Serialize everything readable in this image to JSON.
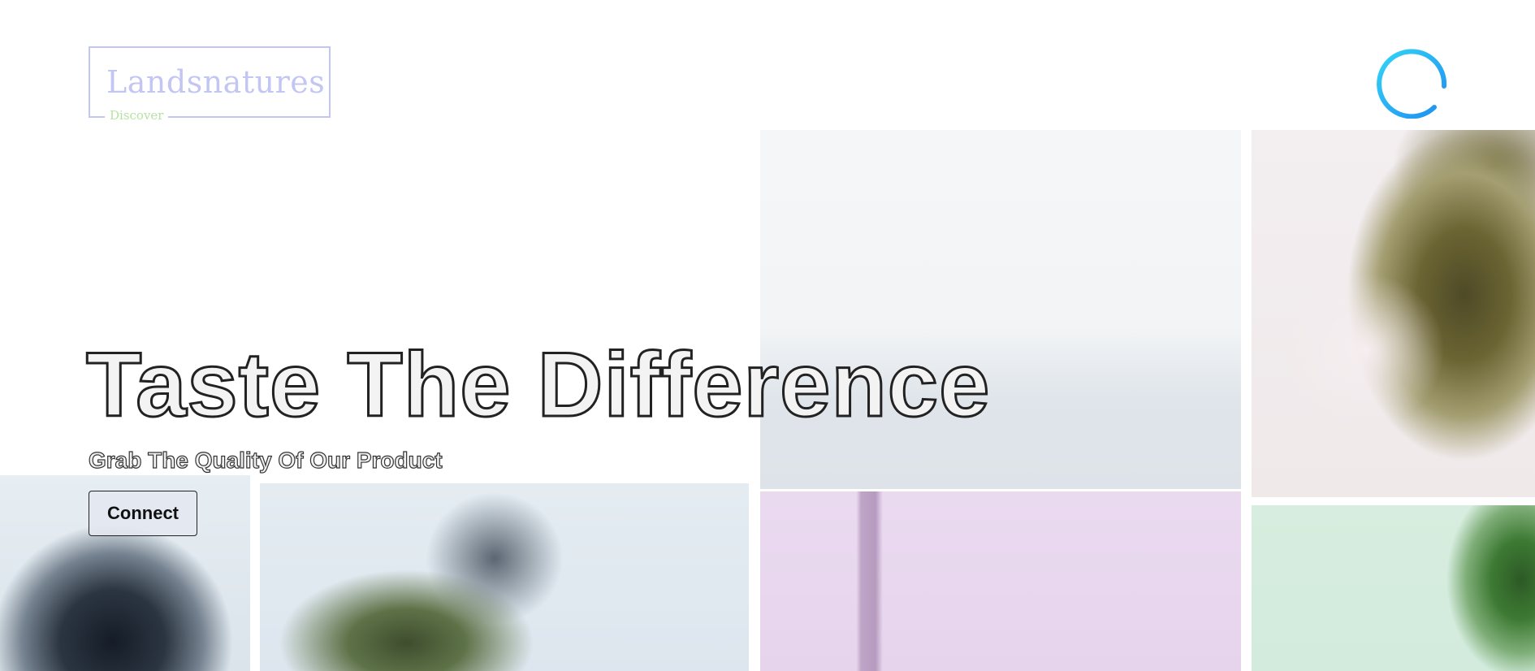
{
  "brand": {
    "name": "Landsnatures",
    "tagline": "Discover",
    "border_color": "#c3c6f2",
    "tagline_color": "#b6e3a3"
  },
  "header": {
    "menu_icon": "hamburger-menu-icon",
    "menu_accent": "#2ec4f5"
  },
  "hero": {
    "title": "Taste The Difference",
    "subtitle": "Grab The Quality Of Our Product",
    "cta_label": "Connect"
  },
  "background": {
    "description_icon": "photo-grid",
    "tile_count": 6
  }
}
